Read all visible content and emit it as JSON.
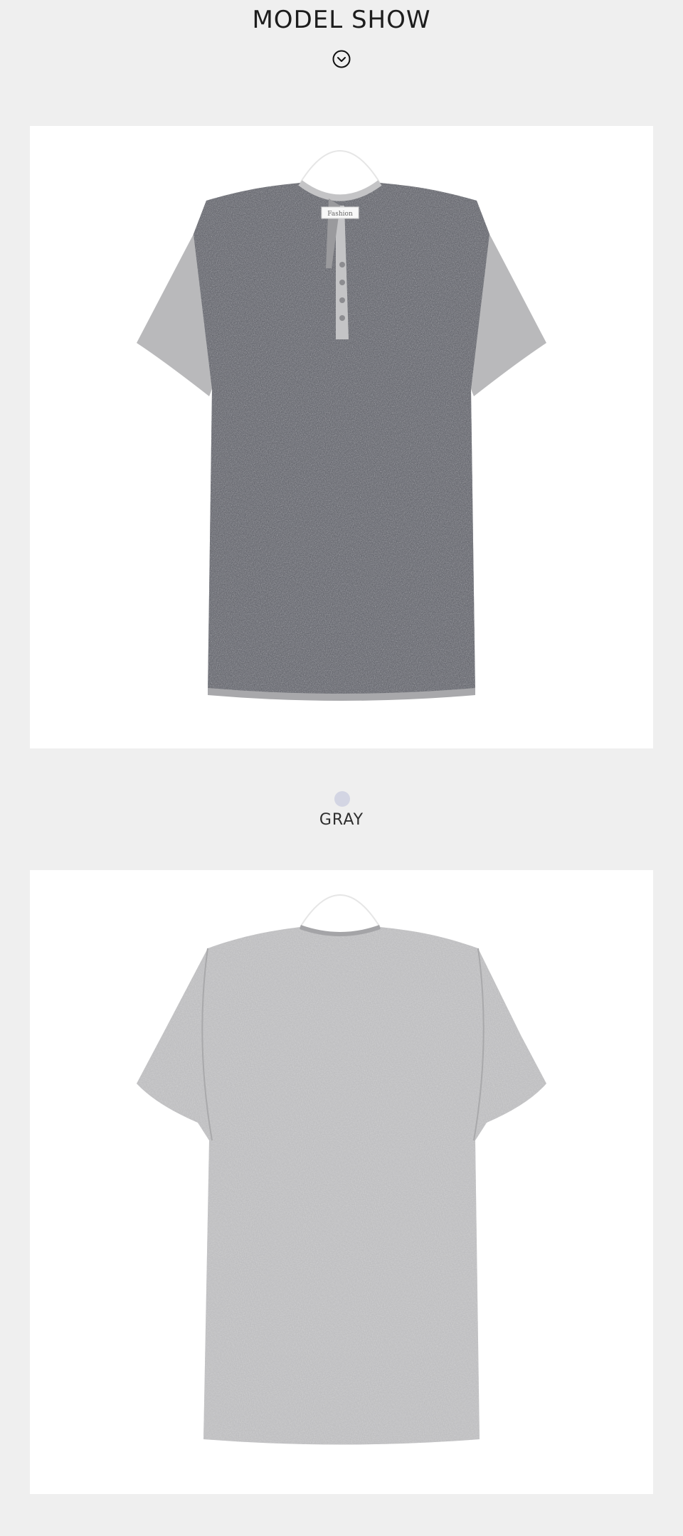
{
  "header": {
    "title": "MODEL SHOW",
    "icon": "chevron-down-circle-icon"
  },
  "front_image": {
    "tag_text": "Fashion",
    "body_color": "#55575e",
    "sleeve_color": "#b9b9bb",
    "button_count": 4
  },
  "color_option": {
    "label": "GRAY",
    "swatch_color": "#d3d5e3"
  },
  "back_image": {
    "body_color": "#b9b9bb"
  }
}
